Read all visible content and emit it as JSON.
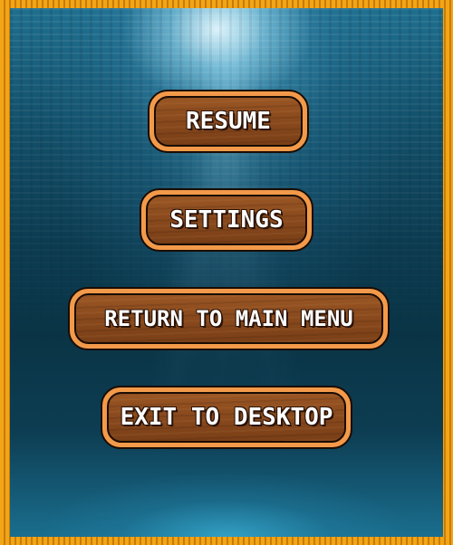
{
  "pause_menu": {
    "buttons": [
      {
        "label": "RESUME"
      },
      {
        "label": "SETTINGS"
      },
      {
        "label": "RETURN TO MAIN MENU"
      },
      {
        "label": "EXIT TO DESKTOP"
      }
    ]
  },
  "colors": {
    "frame_gold": "#f0a018",
    "button_border": "#f29a4a",
    "button_wood": "#8a4a1d",
    "water_deep": "#0c3b50",
    "water_light": "#1f6f8f"
  }
}
